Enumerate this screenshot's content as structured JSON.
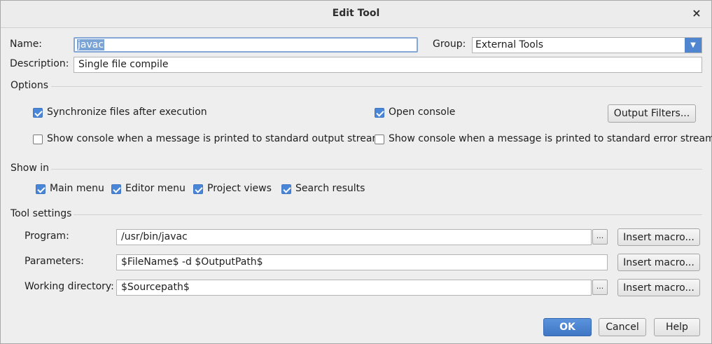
{
  "window": {
    "title": "Edit Tool",
    "close_glyph": "×",
    "close_icon": "close-icon"
  },
  "form": {
    "name_label": "Name:",
    "name_value": "javac",
    "group_label": "Group:",
    "group_value": "External Tools",
    "description_label": "Description:",
    "description_value": "Single file compile"
  },
  "options": {
    "header": "Options",
    "sync_files": {
      "label": "Synchronize files after execution",
      "checked": true
    },
    "open_console": {
      "label": "Open console",
      "checked": true
    },
    "output_filters_button": "Output Filters...",
    "show_console_stdout": {
      "label": "Show console when a message is printed to standard output stream",
      "checked": false
    },
    "show_console_stderr": {
      "label": "Show console when a message is printed to standard error stream",
      "checked": false
    }
  },
  "show_in": {
    "header": "Show in",
    "items": [
      {
        "label": "Main menu",
        "checked": true
      },
      {
        "label": "Editor menu",
        "checked": true
      },
      {
        "label": "Project views",
        "checked": true
      },
      {
        "label": "Search results",
        "checked": true
      }
    ]
  },
  "tool_settings": {
    "header": "Tool settings",
    "program_label": "Program:",
    "program_value": "/usr/bin/javac",
    "parameters_label": "Parameters:",
    "parameters_value": "$FileName$ -d $OutputPath$",
    "working_dir_label": "Working directory:",
    "working_dir_value": "$Sourcepath$",
    "browse_label": "...",
    "insert_macro_label": "Insert macro..."
  },
  "buttons": {
    "ok": "OK",
    "cancel": "Cancel",
    "help": "Help"
  },
  "colors": {
    "accent": "#4a86d8",
    "primary_button": "#4f86cf"
  }
}
